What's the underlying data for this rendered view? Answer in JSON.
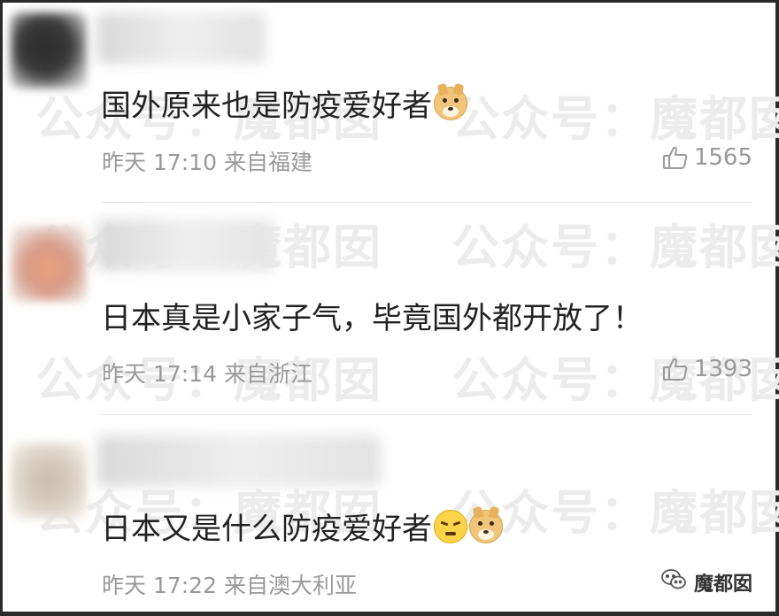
{
  "watermark": "公众号：魔都囡",
  "comments": [
    {
      "text": "国外原来也是防疫爱好者",
      "emojis": [
        "doge-icon"
      ],
      "time": "昨天 17:10",
      "location": "来自福建",
      "likes": "1565"
    },
    {
      "text": "日本真是小家子气，毕竟国外都开放了！",
      "emojis": [],
      "time": "昨天 17:14",
      "location": "来自浙江",
      "likes": "1393"
    },
    {
      "text": "日本又是什么防疫爱好者",
      "emojis": [
        "angry-face-icon",
        "doge-icon"
      ],
      "time": "昨天 17:22",
      "location": "来自澳大利亚",
      "likes": ""
    }
  ],
  "badge": {
    "label": "魔都囡"
  },
  "colors": {
    "meta_gray": "#999999",
    "text_dark": "#222222",
    "divider": "#e3e3e3"
  }
}
